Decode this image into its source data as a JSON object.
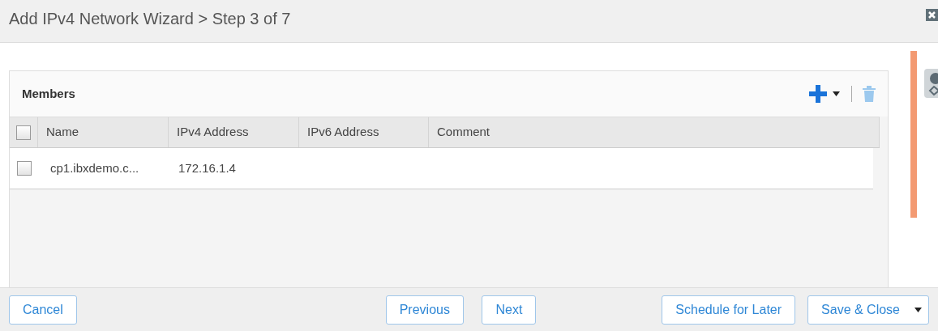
{
  "window": {
    "title": "Add IPv4 Network Wizard > Step 3 of 7"
  },
  "panel": {
    "title": "Members",
    "select_all": {
      "checked": false
    },
    "columns": [
      "Name",
      "IPv4 Address",
      "IPv6 Address",
      "Comment"
    ],
    "rows": [
      {
        "checked": false,
        "cells": [
          "cp1.ibxdemo.c...",
          "172.16.1.4",
          "",
          ""
        ]
      }
    ]
  },
  "footer": {
    "left": [
      {
        "label": "Cancel",
        "kind": "plain"
      }
    ],
    "center": [
      {
        "label": "Previous",
        "kind": "plain"
      },
      {
        "label": "Next",
        "kind": "plain"
      }
    ],
    "right": [
      {
        "label": "Schedule for Later",
        "kind": "plain"
      },
      {
        "label": "Save & Close",
        "kind": "split"
      }
    ]
  }
}
